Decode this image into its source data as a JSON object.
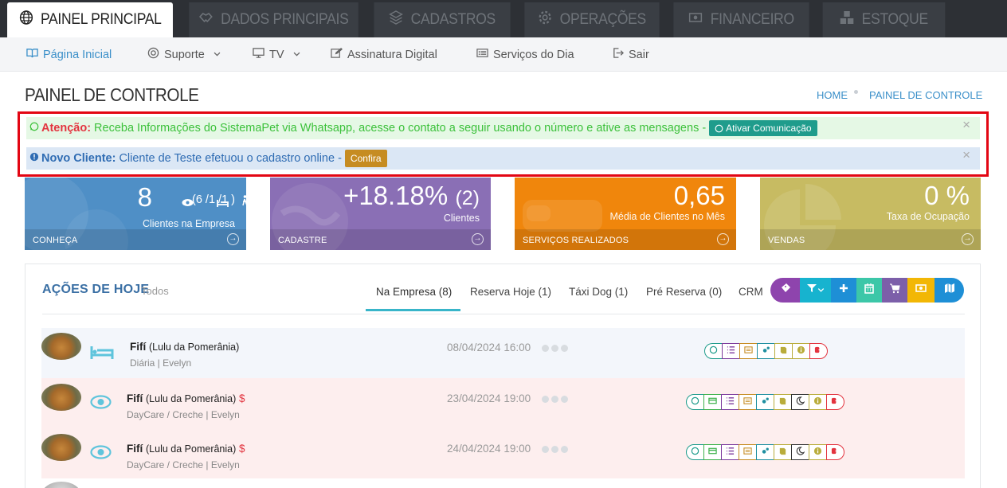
{
  "topnav": {
    "tabs": [
      {
        "label": "PAINEL PRINCIPAL",
        "icon": "globe-icon",
        "active": true
      },
      {
        "label": "DADOS PRINCIPAIS",
        "icon": "handshake-icon"
      },
      {
        "label": "CADASTROS",
        "icon": "layers-icon"
      },
      {
        "label": "OPERAÇÕES",
        "icon": "gear-icon"
      },
      {
        "label": "FINANCEIRO",
        "icon": "money-icon"
      },
      {
        "label": "ESTOQUE",
        "icon": "cubes-icon"
      }
    ]
  },
  "subnav": {
    "items": [
      {
        "label": "Página Inicial",
        "icon": "book-icon"
      },
      {
        "label": "Suporte",
        "icon": "lifebuoy-icon"
      },
      {
        "label": "TV",
        "icon": "monitor-icon"
      },
      {
        "label": "Assinatura Digital",
        "icon": "edit-icon"
      },
      {
        "label": "Serviços do Dia",
        "icon": "list-card-icon"
      },
      {
        "label": "Sair",
        "icon": "sign-out-icon"
      }
    ]
  },
  "page": {
    "title": "PAINEL DE CONTROLE",
    "breadcrumb": [
      "HOME",
      "PAINEL DE CONTROLE"
    ]
  },
  "alerts": {
    "whatsapp": {
      "strong": "Atenção:",
      "text": "Receba Informações do SistemaPet via Whatsapp, acesse o contato a seguir usando o número e ative as mensagens -",
      "button": "Ativar Comunicação",
      "close": "×"
    },
    "novo_cliente": {
      "strong": "Novo Cliente:",
      "text": "Cliente de Teste efetuou o cadastro online -",
      "button": "Confira",
      "close": "×"
    }
  },
  "cards": [
    {
      "value": "8",
      "detail": "(6 /1 /1 )",
      "label": "Clientes na Empresa",
      "footer": "CONHEÇA",
      "color": "#4f8fc6"
    },
    {
      "value": "+18.18%",
      "detail": "(2)",
      "label": "Clientes",
      "footer": "CADASTRE",
      "color": "#8a6fb5"
    },
    {
      "value": "0,65",
      "detail": "",
      "label": "Média de Clientes no Mês",
      "footer": "SERVIÇOS REALIZADOS",
      "color": "#f0860c"
    },
    {
      "value": "0 %",
      "detail": "",
      "label": "Taxa de Ocupação",
      "footer": "VENDAS",
      "color": "#c7bb62"
    }
  ],
  "acoes": {
    "title": "AÇÕES DE HOJE",
    "filter": "Todos",
    "tabs": [
      "Na Empresa (8)",
      "Reserva Hoje (1)",
      "Táxi Dog (1)",
      "Pré Reserva (0)",
      "CRM"
    ],
    "toolbar_colors": [
      "#8e44ad",
      "#17b3cf",
      "#1e8fd6",
      "#3cc7a8",
      "#7c5fa9",
      "#f2b705",
      "#1e8fd6"
    ],
    "rows": [
      {
        "name": "Fifí",
        "breed": "(Lulu da Pomerânia)",
        "money": "",
        "service": "Diária | Evelyn",
        "datetime": "08/04/2024 16:00",
        "type": "bed-icon"
      },
      {
        "name": "Fifí",
        "breed": "(Lulu da Pomerânia)",
        "money": "$",
        "service": "DayCare / Creche | Evelyn",
        "datetime": "23/04/2024 19:00",
        "type": "eye-icon"
      },
      {
        "name": "Fifí",
        "breed": "(Lulu da Pomerânia)",
        "money": "$",
        "service": "DayCare / Creche | Evelyn",
        "datetime": "24/04/2024 19:00",
        "type": "eye-icon"
      }
    ]
  }
}
